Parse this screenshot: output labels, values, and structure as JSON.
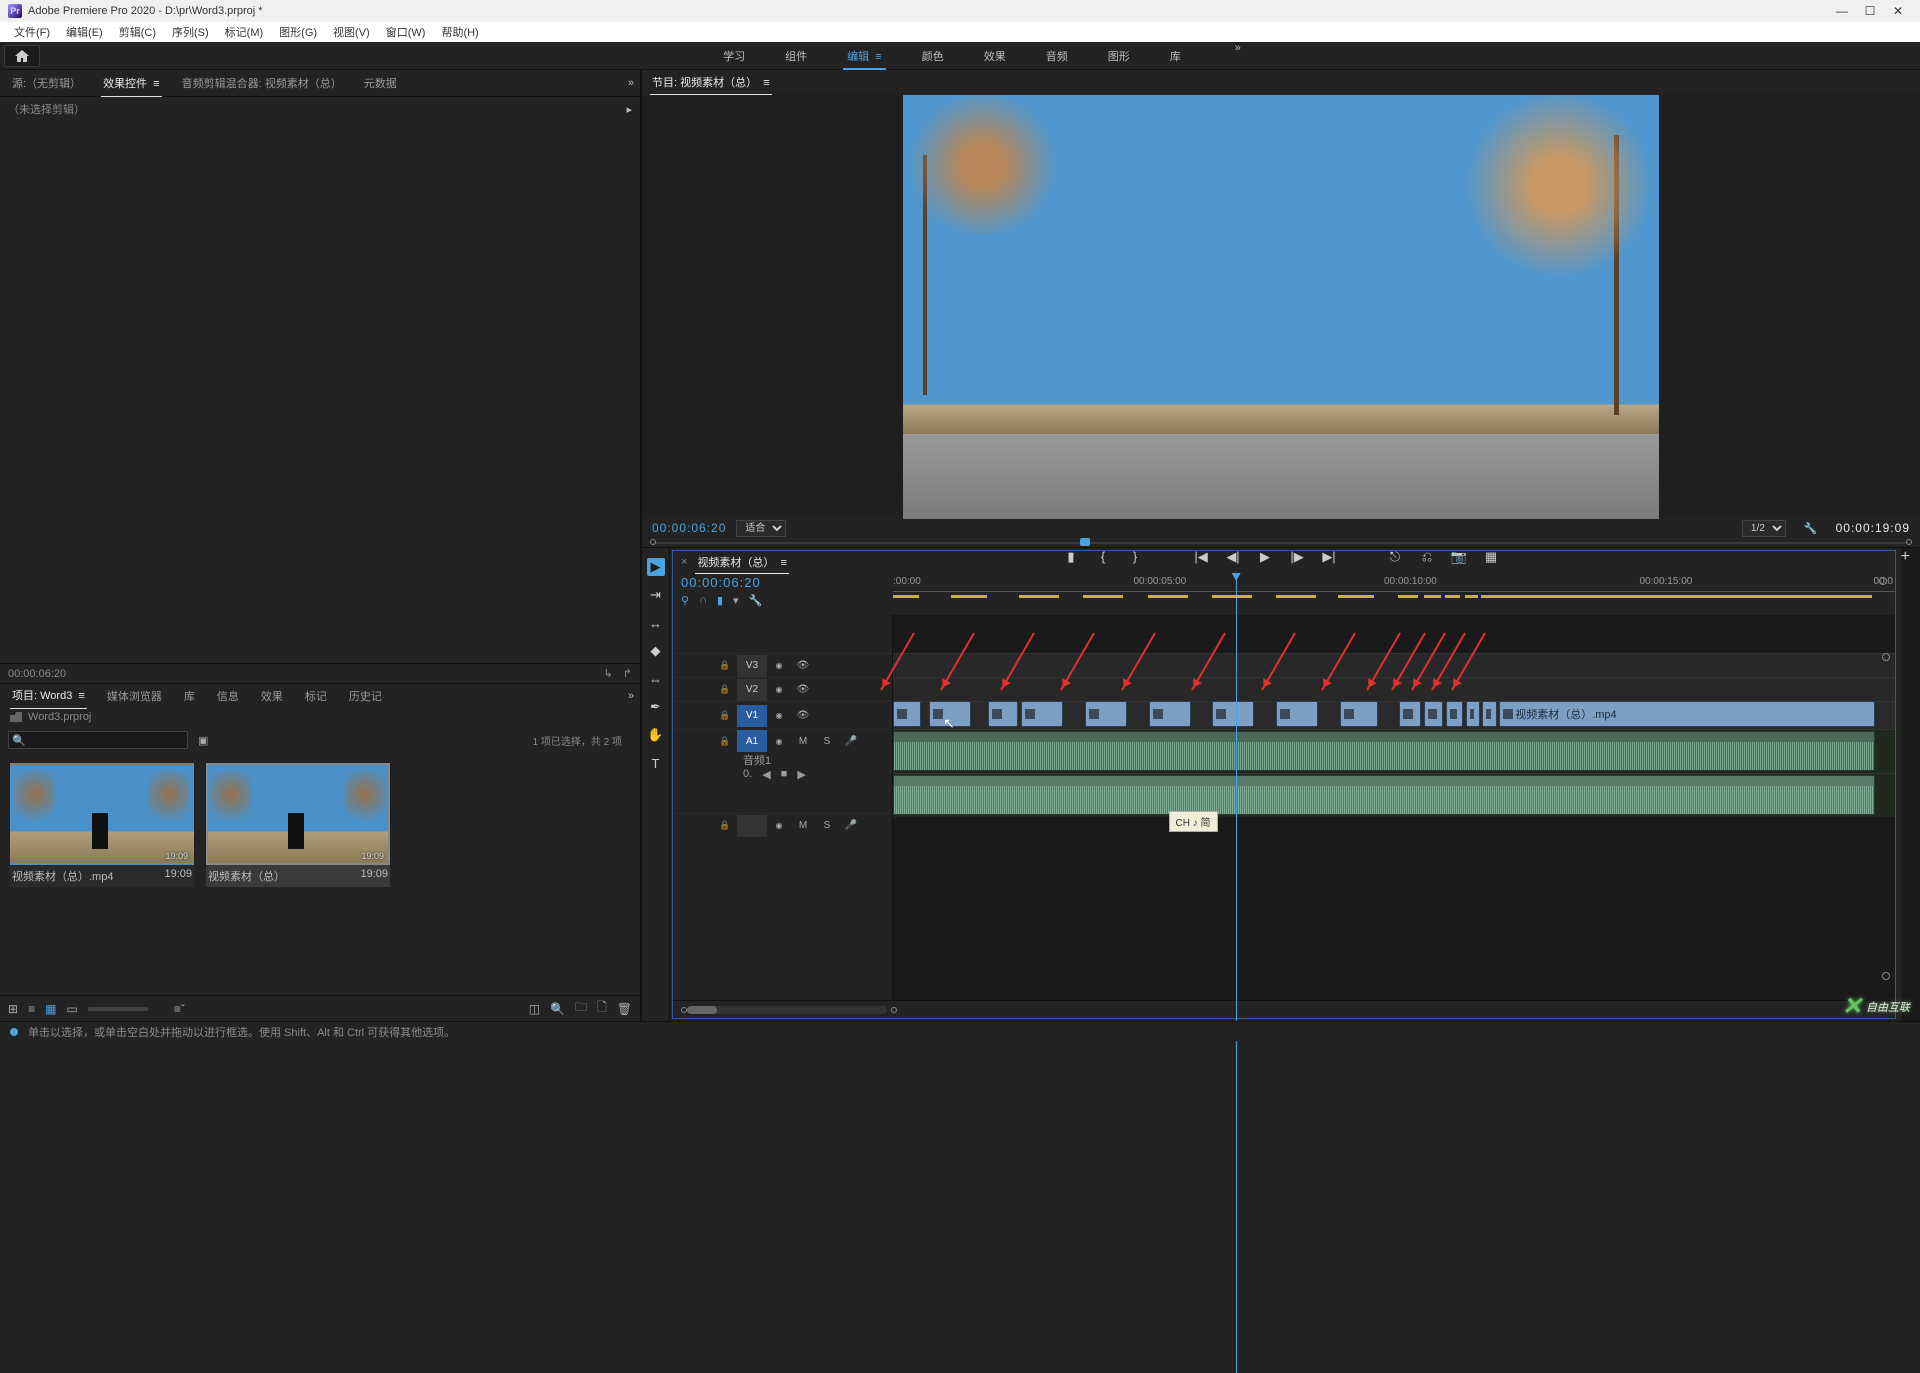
{
  "titlebar": {
    "app": "Adobe Premiere Pro 2020",
    "doc": "D:\\pr\\Word3.prproj *"
  },
  "menus": [
    "文件(F)",
    "编辑(E)",
    "剪辑(C)",
    "序列(S)",
    "标记(M)",
    "图形(G)",
    "视图(V)",
    "窗口(W)",
    "帮助(H)"
  ],
  "workspaces": [
    "学习",
    "组件",
    "编辑",
    "颜色",
    "效果",
    "音频",
    "图形",
    "库"
  ],
  "workspace_active": 2,
  "left_tabs": [
    "源:（无剪辑）",
    "效果控件",
    "音频剪辑混合器: 视频素材（总）",
    "元数据"
  ],
  "left_tabs_active": 1,
  "effect_control_placeholder": "（未选择剪辑）",
  "lower_left_status_tc": "00:00:06:20",
  "lower_left_tabs": [
    "项目: Word3",
    "媒体浏览器",
    "库",
    "信息",
    "效果",
    "标记",
    "历史记"
  ],
  "lower_left_active": 0,
  "project_name": "Word3.prproj",
  "project_status": "1 项已选择，共 2 项",
  "search_placeholder": "",
  "thumb1": {
    "name": "视频素材（总）.mp4",
    "dur": "19:09"
  },
  "thumb2": {
    "name": "视频素材（总）",
    "dur": "19:09"
  },
  "program_tab": "节目: 视频素材（总）",
  "program_tc_left": "00:00:06:20",
  "program_fit": "适合",
  "program_zoom_sel": "1/2",
  "program_tc_right": "00:00:19:09",
  "timeline_tab": "视频素材（总）",
  "timeline_tc": "00:00:06:20",
  "ruler_labels": [
    ":00:00",
    "00:00:05:00",
    "00:00:10:00",
    "00:00:15:00",
    "00:0"
  ],
  "tracks_v": [
    "V3",
    "V2",
    "V1"
  ],
  "tracks_a": [
    "A1"
  ],
  "audio_label": "音频1",
  "tail_clip": "视频素材（总）.mp4",
  "tooltip": "CH ♪ 简",
  "footer_hint": "单击以选择，或单击空白处并拖动以进行框选。使用 Shift、Alt 和 Ctrl 可获得其他选项。",
  "watermark": "自由互联",
  "audio_meta": "0."
}
